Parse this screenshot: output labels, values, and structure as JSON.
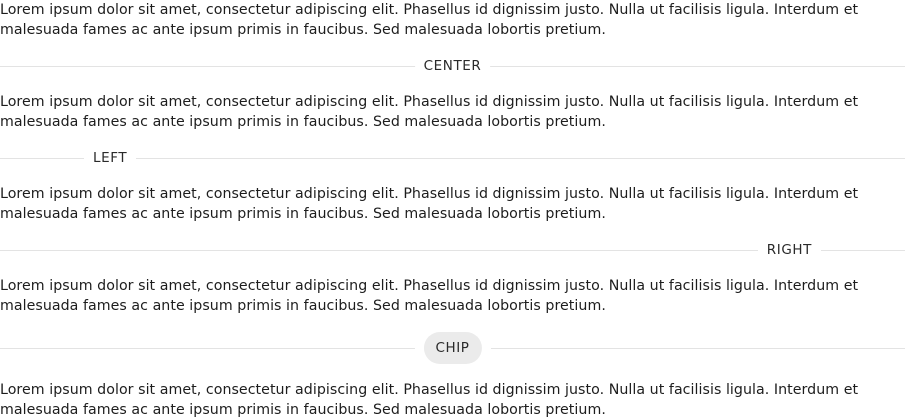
{
  "paragraphs": [
    {
      "line1": "Lorem ipsum dolor sit amet, consectetur adipiscing elit. Phasellus id dignissim justo. Nulla ut facilisis ligula. Interdum et",
      "line2": "malesuada fames ac ante ipsum primis in faucibus. Sed malesuada lobortis pretium."
    },
    {
      "line1": "Lorem ipsum dolor sit amet, consectetur adipiscing elit. Phasellus id dignissim justo. Nulla ut facilisis ligula. Interdum et",
      "line2": "malesuada fames ac ante ipsum primis in faucibus. Sed malesuada lobortis pretium."
    },
    {
      "line1": "Lorem ipsum dolor sit amet, consectetur adipiscing elit. Phasellus id dignissim justo. Nulla ut facilisis ligula. Interdum et",
      "line2": "malesuada fames ac ante ipsum primis in faucibus. Sed malesuada lobortis pretium."
    },
    {
      "line1": "Lorem ipsum dolor sit amet, consectetur adipiscing elit. Phasellus id dignissim justo. Nulla ut facilisis ligula. Interdum et",
      "line2": "malesuada fames ac ante ipsum primis in faucibus. Sed malesuada lobortis pretium."
    },
    {
      "line1": "Lorem ipsum dolor sit amet, consectetur adipiscing elit. Phasellus id dignissim justo. Nulla ut facilisis ligula. Interdum et",
      "line2": "malesuada fames ac ante ipsum primis in faucibus. Sed malesuada lobortis pretium."
    }
  ],
  "dividers": {
    "center_label": "CENTER",
    "left_label": "LEFT",
    "right_label": "RIGHT",
    "chip_label": "CHIP"
  },
  "colors": {
    "divider_line": "#e3e3e3",
    "chip_background": "#ebebeb",
    "text": "#1d1d1d"
  }
}
